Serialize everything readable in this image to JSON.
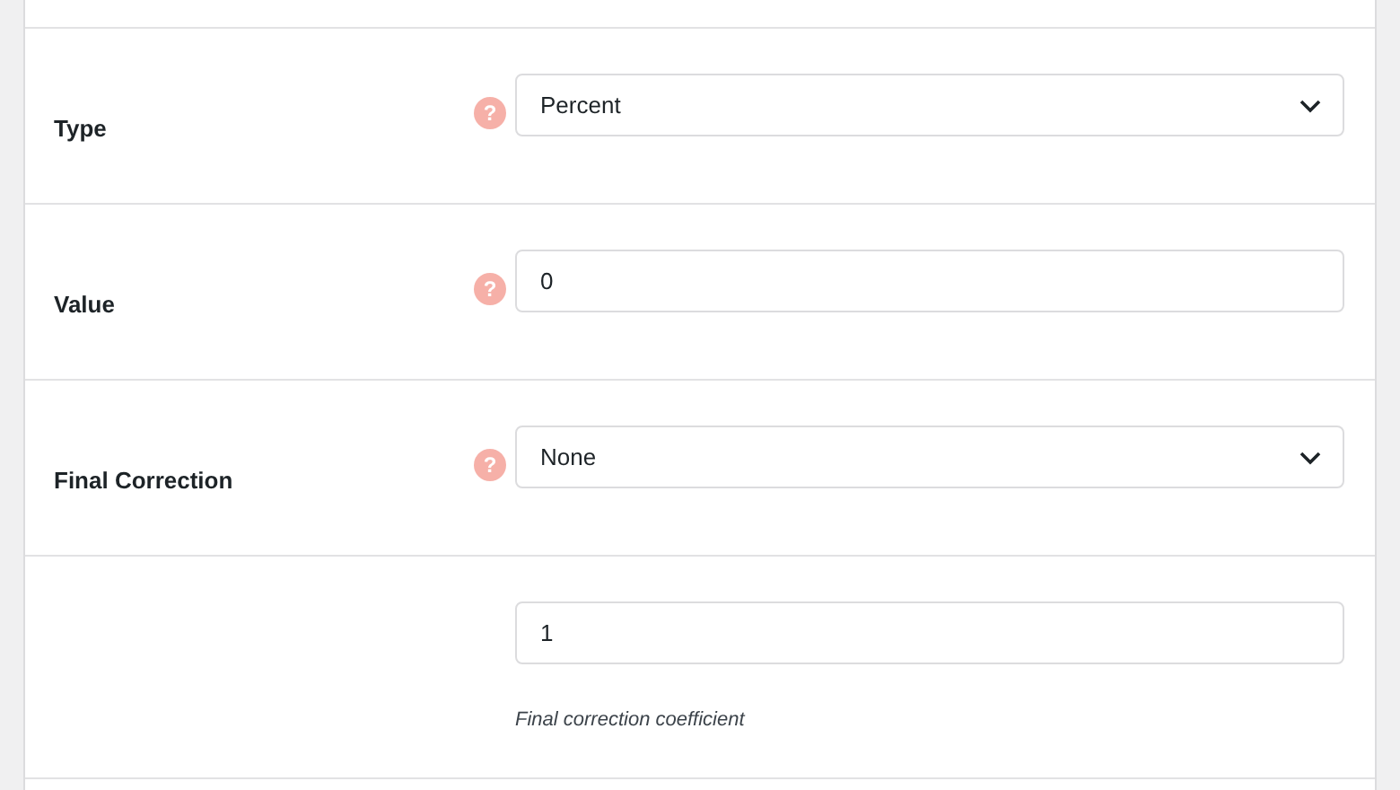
{
  "fields": [
    {
      "kind": "select",
      "label": "Type",
      "help": "?",
      "value": "Percent"
    },
    {
      "kind": "input",
      "label": "Value",
      "help": "?",
      "value": "0"
    },
    {
      "kind": "select",
      "label": "Final Correction",
      "help": "?",
      "value": "None"
    },
    {
      "kind": "input",
      "value": "1",
      "description": "Final correction coefficient"
    }
  ]
}
